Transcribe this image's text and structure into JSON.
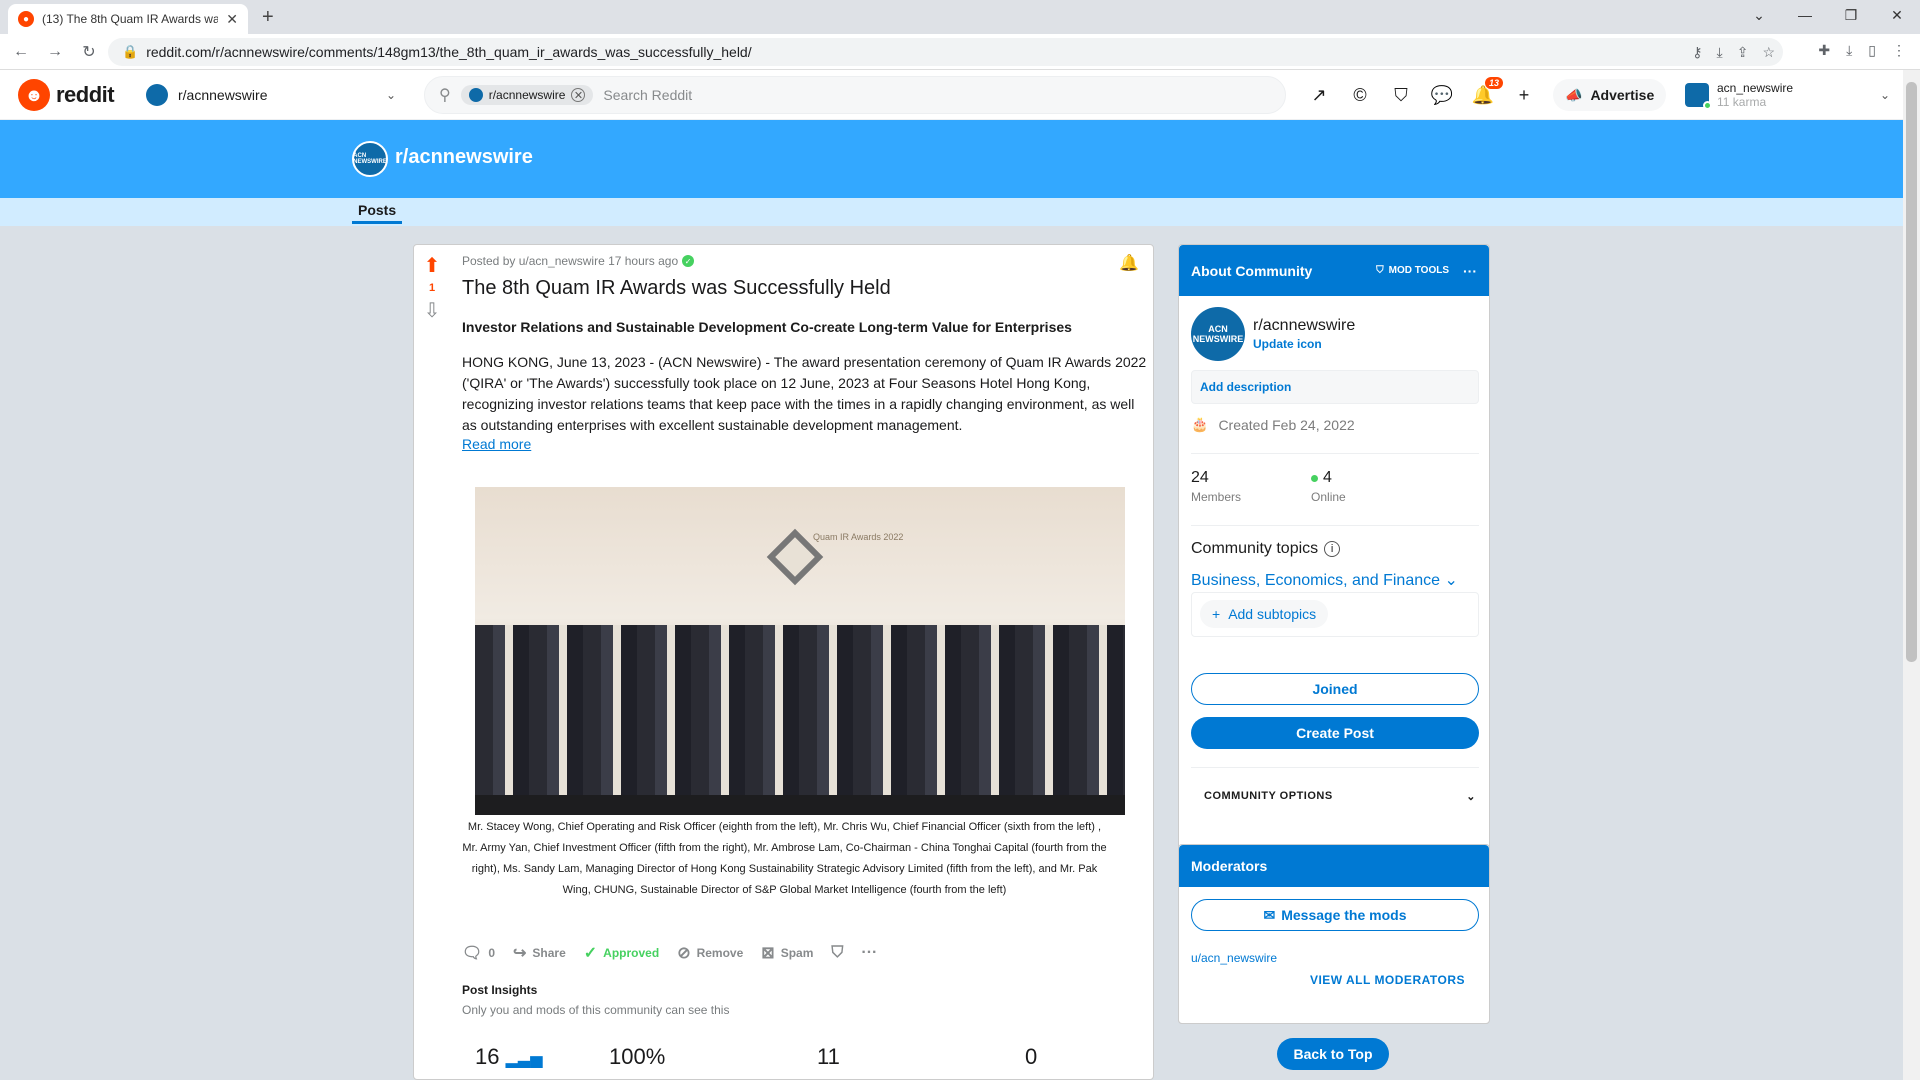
{
  "browser": {
    "tab_title": "(13) The 8th Quam IR Awards wa",
    "url": "reddit.com/r/acnnewswire/comments/148gm13/the_8th_quam_ir_awards_was_successfully_held/"
  },
  "header": {
    "logo_text": "reddit",
    "community_selector": "r/acnnewswire",
    "search_chip": "r/acnnewswire",
    "search_placeholder": "Search Reddit",
    "notification_count": "13",
    "advertise_label": "Advertise",
    "username": "acn_newswire",
    "karma": "11 karma"
  },
  "banner": {
    "avatar_text": "ACN NEWSWIRE",
    "community_name": "r/acnnewswire",
    "tab_posts": "Posts"
  },
  "post": {
    "vote_count": "1",
    "meta": "Posted by u/acn_newswire 17 hours ago",
    "title": "The 8th Quam IR Awards was Successfully Held",
    "subtitle": "Investor Relations and Sustainable Development Co-create Long-term Value for Enterprises",
    "body": "HONG KONG, June 13, 2023 - (ACN Newswire) - The award presentation ceremony of Quam IR Awards 2022 ('QIRA' or 'The Awards') successfully took place on 12 June, 2023 at Four Seasons Hotel Hong Kong, recognizing investor relations teams that keep pace with the times in a rapidly changing environment, as well as outstanding enterprises with excellent sustainable development management.",
    "read_more": "Read more",
    "image_text": "Quam IR Awards 2022",
    "caption": "Mr. Stacey Wong, Chief Operating and Risk Officer (eighth from the left), Mr. Chris Wu, Chief Financial Officer (sixth from the left) , Mr. Army Yan, Chief Investment Officer (fifth from the right), Mr. Ambrose Lam, Co-Chairman - China Tonghai Capital (fourth from the right), Ms. Sandy Lam, Managing Director of Hong Kong Sustainability Strategic Advisory Limited (fifth from the left), and Mr. Pak Wing, CHUNG, Sustainable Director of S&P Global Market Intelligence (fourth from the left)",
    "actions": {
      "comments": "0",
      "share": "Share",
      "approved": "Approved",
      "remove": "Remove",
      "spam": "Spam"
    },
    "insights_title": "Post Insights",
    "insights_sub": "Only you and mods of this community can see this",
    "stats": [
      "16",
      "100%",
      "11",
      "0"
    ]
  },
  "sidebar": {
    "about_title": "About Community",
    "mod_tools": "MOD TOOLS",
    "avatar_text": "ACN NEWSWIRE",
    "community_name": "r/acnnewswire",
    "update_icon": "Update icon",
    "add_description": "Add description",
    "created": "Created Feb 24, 2022",
    "members_count": "24",
    "members_label": "Members",
    "online_count": "4",
    "online_label": "Online",
    "topics_title": "Community topics",
    "topic": "Business, Economics, and Finance",
    "add_subtopics": "Add subtopics",
    "joined": "Joined",
    "create_post": "Create Post",
    "community_options": "COMMUNITY OPTIONS"
  },
  "moderators": {
    "title": "Moderators",
    "message_mods": "Message the mods",
    "mod_name": "u/acn_newswire",
    "view_all": "VIEW ALL MODERATORS"
  },
  "back_to_top": "Back to Top",
  "colors": {
    "reddit_orange": "#ff4500",
    "blue": "#0079d3",
    "banner": "#33a8ff",
    "approved_green": "#46d160"
  }
}
